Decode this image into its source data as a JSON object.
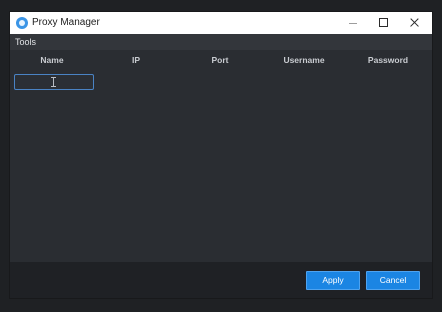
{
  "window": {
    "title": "Proxy Manager"
  },
  "menu": {
    "tools": "Tools"
  },
  "table": {
    "columns": [
      "Name",
      "IP",
      "Port",
      "Username",
      "Password"
    ]
  },
  "footer": {
    "apply_label": "Apply",
    "cancel_label": "Cancel"
  },
  "theme": {
    "accent": "#1b85e3",
    "background": "#2a2d32"
  }
}
